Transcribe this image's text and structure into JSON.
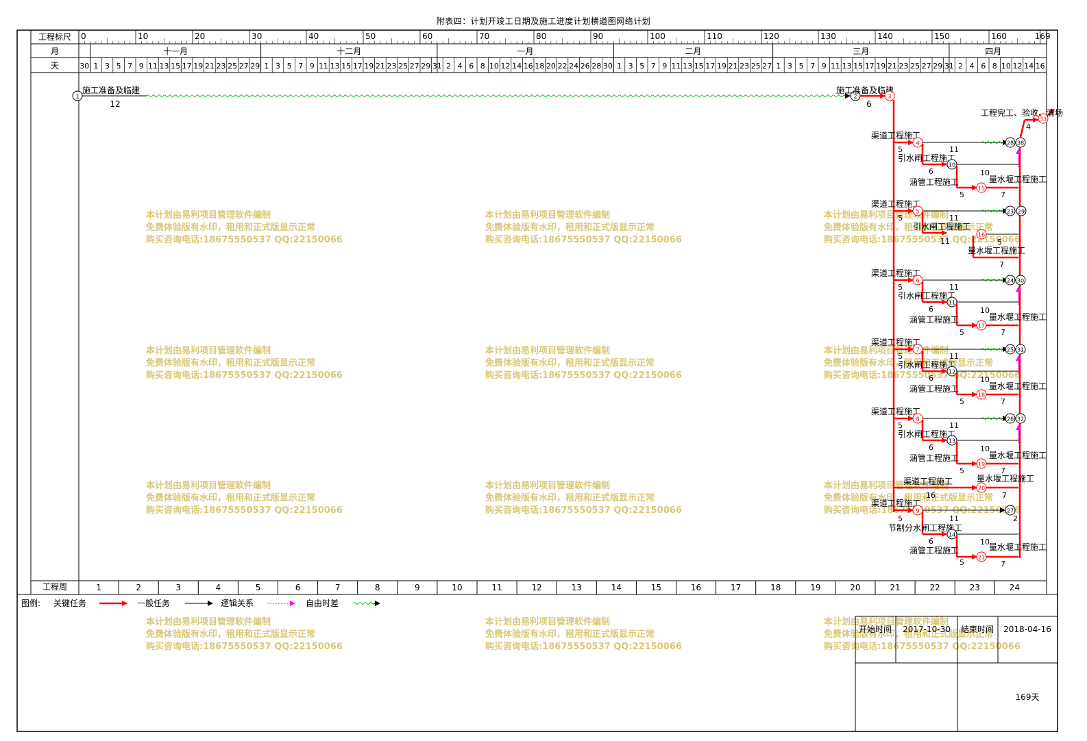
{
  "title": "附表四：计划开竣工日期及施工进度计划横道图网络计划",
  "header": {
    "scale_label": "工程标尺",
    "month_label": "月",
    "day_label": "天",
    "week_label": "工程周",
    "scale_ticks": [
      "0",
      "10",
      "20",
      "30",
      "40",
      "50",
      "60",
      "70",
      "80",
      "90",
      "100",
      "110",
      "120",
      "130",
      "140",
      "150",
      "160",
      "169"
    ],
    "months": [
      "十一月",
      "十二月",
      "一月",
      "二月",
      "三月",
      "四月"
    ],
    "weeks": [
      "1",
      "2",
      "3",
      "4",
      "5",
      "6",
      "7",
      "8",
      "9",
      "10",
      "11",
      "12",
      "13",
      "14",
      "15",
      "16",
      "17",
      "18",
      "19",
      "20",
      "21",
      "22",
      "23",
      "24"
    ]
  },
  "legend": {
    "prefix": "图例:",
    "critical": "关键任务",
    "normal": "一般任务",
    "logic": "逻辑关系",
    "free_float": "自由时差"
  },
  "info": {
    "start_label": "开始时间",
    "start_value": "2017-10-30",
    "end_label": "结束时间",
    "end_value": "2018-04-16",
    "duration": "169天"
  },
  "watermark": {
    "line1": "本计划由易利项目管理软件编制",
    "line2": "免费体验版有水印，租用和正式版显示正常",
    "line3": "购买咨询电话:18675550537 QQ:22150066"
  },
  "colors": {
    "critical": "#ff0000",
    "normal": "#000000",
    "logic": "#ff00ff",
    "free_float": "#00c000",
    "watermark": "#d8c878"
  },
  "tasks": {
    "prep1": {
      "name": "施工准备及临建",
      "duration": "12"
    },
    "prep2": {
      "name": "施工准备及临建",
      "duration": "6"
    },
    "completion": {
      "name": "工程完工、验收、清场",
      "duration": "4"
    },
    "canal": "渠道工程施工",
    "sluice": "引水闸工程施工",
    "culvert": "涵管工程施工",
    "weir": "量水堰工程施工",
    "divider": "节制分水闸工程施工",
    "canal16": {
      "name": "渠道工程施工",
      "duration": "16"
    }
  }
}
